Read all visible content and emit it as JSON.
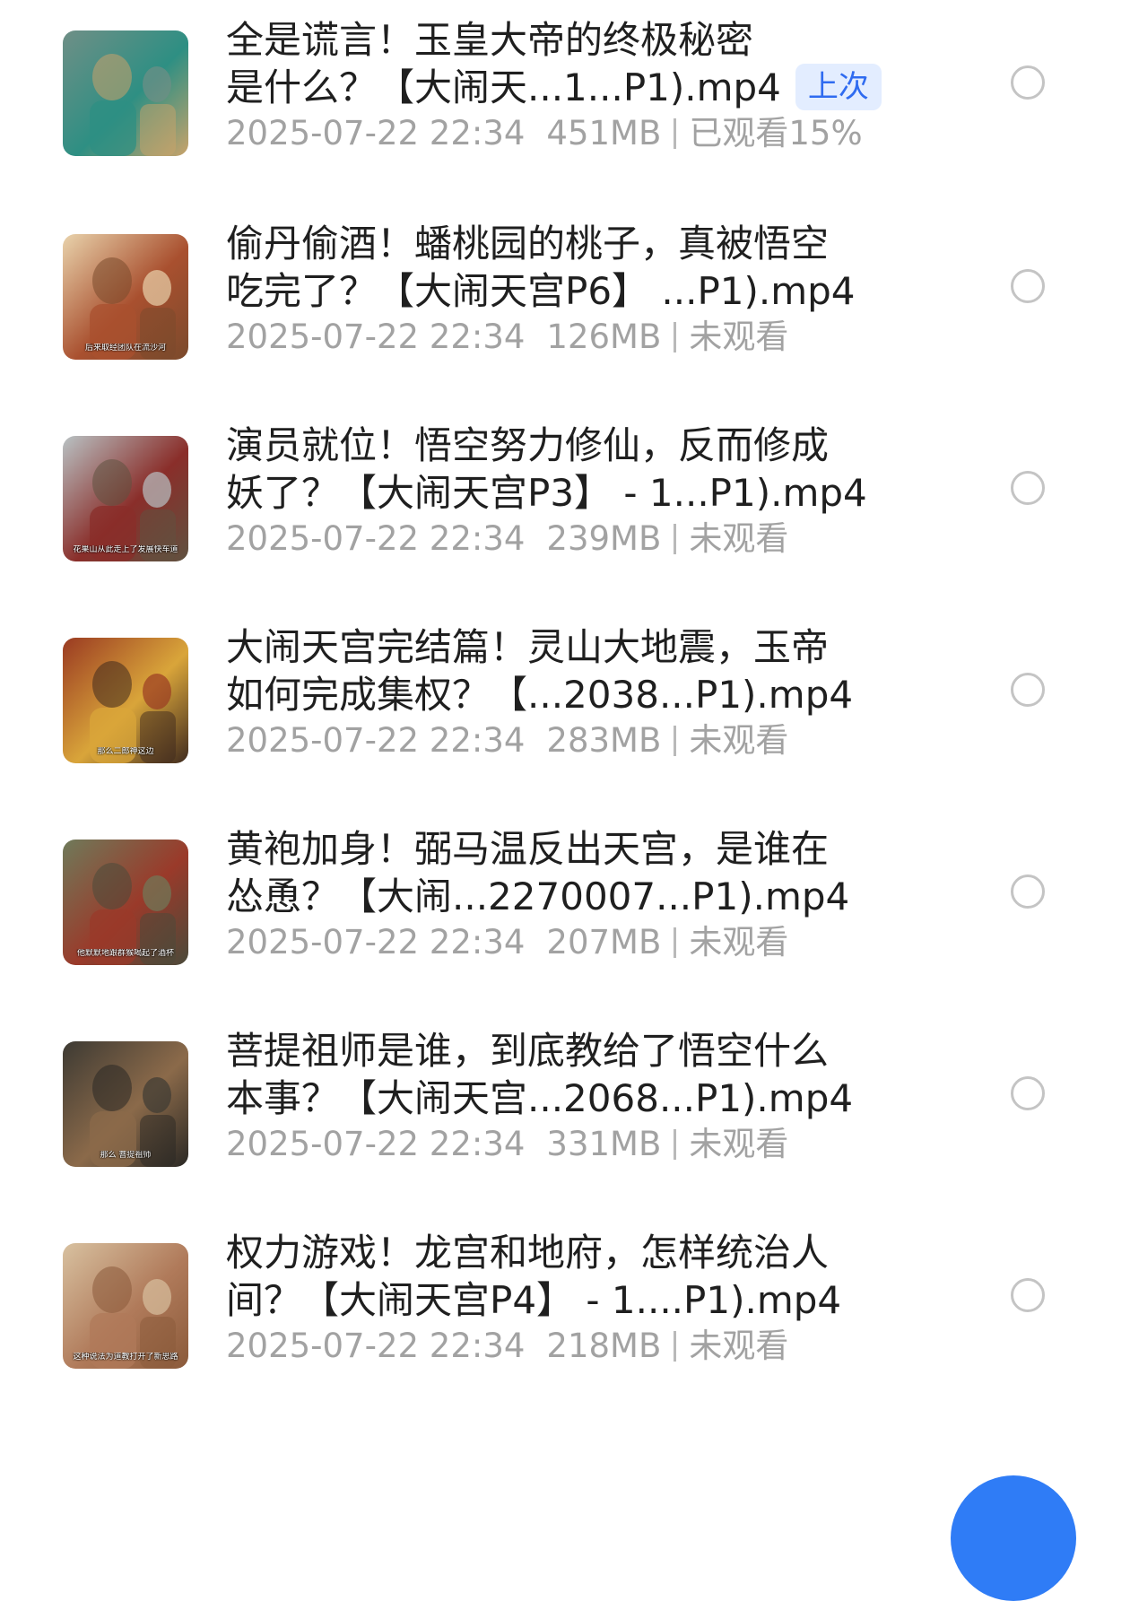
{
  "items": [
    {
      "title_line1": "全是谎言！玉皇大帝的终极秘密",
      "title_line2": "是什么？【大闹天...1...P1).mp4",
      "badge": "上次",
      "date": "2025-07-22 22:34",
      "size": "451MB",
      "status": "已观看15%",
      "thumb_caption": "",
      "thumb_colors": [
        "#6f8f86",
        "#2e8f83",
        "#c9a36a"
      ]
    },
    {
      "title_line1": "偷丹偷酒！蟠桃园的桃子，真被悟空",
      "title_line2": "吃完了？【大闹天宫P6】 ...P1).mp4",
      "badge": "",
      "date": "2025-07-22 22:34",
      "size": "126MB",
      "status": "未观看",
      "thumb_caption": "后来取经团队在流沙河",
      "thumb_colors": [
        "#e9d3ac",
        "#a9502f",
        "#7a4a2c"
      ]
    },
    {
      "title_line1": "演员就位！悟空努力修仙，反而修成",
      "title_line2": "妖了？【大闹天宫P3】 - 1...P1).mp4",
      "badge": "",
      "date": "2025-07-22 22:34",
      "size": "239MB",
      "status": "未观看",
      "thumb_caption": "花果山从此走上了发展快车道",
      "thumb_colors": [
        "#b9c2c4",
        "#8a2e2a",
        "#5f5240"
      ]
    },
    {
      "title_line1": "大闹天宫完结篇！灵山大地震，玉帝",
      "title_line2": "如何完成集权？【...2038...P1).mp4",
      "badge": "",
      "date": "2025-07-22 22:34",
      "size": "283MB",
      "status": "未观看",
      "thumb_caption": "那么二郎神这边",
      "thumb_colors": [
        "#9a3a22",
        "#d9a53a",
        "#3f2a1e"
      ]
    },
    {
      "title_line1": "黄袍加身！弼马温反出天宫，是谁在",
      "title_line2": "怂恿？【大闹...2270007...P1).mp4",
      "badge": "",
      "date": "2025-07-22 22:34",
      "size": "207MB",
      "status": "未观看",
      "thumb_caption": "他默默地跟群猴喝起了酒杯",
      "thumb_colors": [
        "#6f7a5a",
        "#9a3a2a",
        "#4a4a3a"
      ]
    },
    {
      "title_line1": "菩提祖师是谁，到底教给了悟空什么",
      "title_line2": "本事？【大闹天宫...2068...P1).mp4",
      "badge": "",
      "date": "2025-07-22 22:34",
      "size": "331MB",
      "status": "未观看",
      "thumb_caption": "那么 菩提祖师",
      "thumb_colors": [
        "#3d3a33",
        "#8b6a4a",
        "#2a2824"
      ]
    },
    {
      "title_line1": "权力游戏！龙宫和地府，怎样统治人",
      "title_line2": "间？【大闹天宫P4】 - 1....P1).mp4",
      "badge": "",
      "date": "2025-07-22 22:34",
      "size": "218MB",
      "status": "未观看",
      "thumb_caption": "这种说法为道教打开了新思路",
      "thumb_colors": [
        "#d8c1a0",
        "#b07a5a",
        "#8a5a3a"
      ]
    }
  ]
}
